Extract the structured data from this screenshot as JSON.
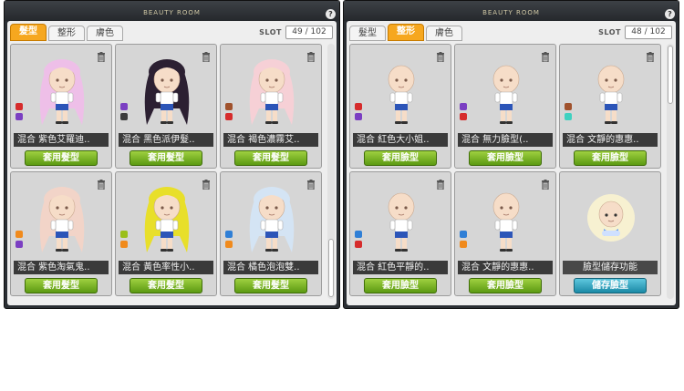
{
  "hair_window": {
    "title": "BEAUTY ROOM",
    "help": "?",
    "tabs": [
      "髮型",
      "整形",
      "膚色"
    ],
    "slot_label": "SLOT",
    "slot_value": "49 / 102",
    "cards": [
      {
        "name": "混合 紫色艾羅迪..",
        "button": "套用髮型",
        "swatches": [
          "#d62c2c",
          "#7b3fc2"
        ],
        "hair": "#eebfe8"
      },
      {
        "name": "混合 黑色派伊髮..",
        "button": "套用髮型",
        "swatches": [
          "#7b3fc2",
          "#3b3b3b"
        ],
        "hair": "#2c2032"
      },
      {
        "name": "混合 褐色濃霧艾..",
        "button": "套用髮型",
        "swatches": [
          "#a0522d",
          "#d62c2c"
        ],
        "hair": "#f6d0d6"
      },
      {
        "name": "混合 紫色淘氣鬼..",
        "button": "套用髮型",
        "swatches": [
          "#f08a1c",
          "#7b3fc2"
        ],
        "hair": "#f2d4c8"
      },
      {
        "name": "混合 黃色率性小..",
        "button": "套用髮型",
        "swatches": [
          "#9bbf1a",
          "#f08a1c"
        ],
        "hair": "#e8df2a"
      },
      {
        "name": "混合 橘色泡泡雙..",
        "button": "套用髮型",
        "swatches": [
          "#2f7fd6",
          "#f08a1c"
        ],
        "hair": "#d4e4f4"
      }
    ]
  },
  "face_window": {
    "title": "BEAUTY ROOM",
    "help": "?",
    "tabs": [
      "髮型",
      "整形",
      "膚色"
    ],
    "slot_label": "SLOT",
    "slot_value": "48 / 102",
    "cards": [
      {
        "name": "混合 紅色大小姐..",
        "button": "套用臉型",
        "swatches": [
          "#d62c2c",
          "#7b3fc2"
        ]
      },
      {
        "name": "混合 無力臉型(..",
        "button": "套用臉型",
        "swatches": [
          "#7b3fc2",
          "#d62c2c"
        ]
      },
      {
        "name": "混合 文靜的惠惠..",
        "button": "套用臉型",
        "swatches": [
          "#a0522d",
          "#3fd1c0"
        ]
      },
      {
        "name": "混合 紅色平靜的..",
        "button": "套用臉型",
        "swatches": [
          "#2f7fd6",
          "#d62c2c"
        ]
      },
      {
        "name": "混合 文靜的惠惠..",
        "button": "套用臉型",
        "swatches": [
          "#2f7fd6",
          "#f08a1c"
        ]
      },
      {
        "name": "臉型儲存功能",
        "button": "儲存臉型",
        "swatches": []
      }
    ]
  }
}
